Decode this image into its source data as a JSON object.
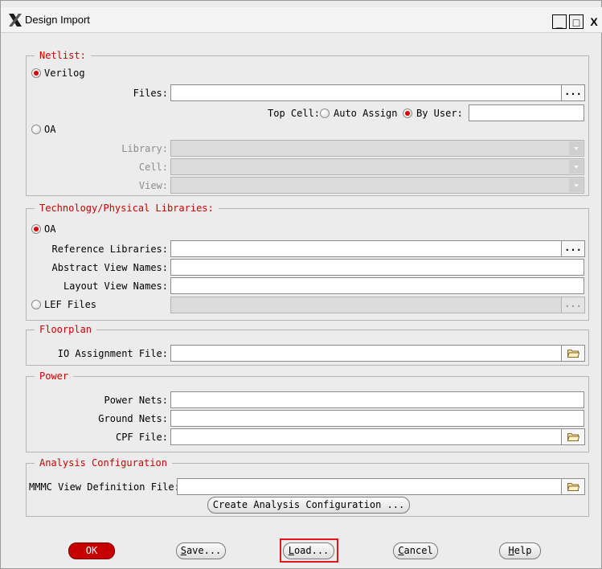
{
  "window": {
    "title": "Design Import",
    "min_label": "_",
    "max_label": "□",
    "close_label": "X"
  },
  "netlist": {
    "legend": "Netlist:",
    "verilog_label": "Verilog",
    "verilog_selected": true,
    "files_label": "Files:",
    "files_value": "",
    "browse_label": "...",
    "top_cell_label": "Top Cell:",
    "auto_assign_label": "Auto Assign",
    "by_user_label": "By User:",
    "by_user_selected": true,
    "top_cell_value": "",
    "oa_label": "OA",
    "oa_selected": false,
    "library_label": "Library:",
    "cell_label": "Cell:",
    "view_label": "View:"
  },
  "tech": {
    "legend": "Technology/Physical Libraries:",
    "oa_label": "OA",
    "oa_selected": true,
    "ref_libs_label": "Reference Libraries:",
    "browse_label": "...",
    "abstract_label": "Abstract View Names:",
    "layout_label": "Layout View Names:",
    "lef_label": "LEF Files",
    "lef_selected": false,
    "lef_browse_label": "..."
  },
  "floorplan": {
    "legend": "Floorplan",
    "io_label": "IO Assignment File:",
    "io_value": ""
  },
  "power": {
    "legend": "Power",
    "power_nets_label": "Power Nets:",
    "ground_nets_label": "Ground Nets:",
    "cpf_label": "CPF File:"
  },
  "analysis": {
    "legend": "Analysis Configuration",
    "mmmc_label": "MMMC View Definition File:",
    "create_button": "Create Analysis Configuration ..."
  },
  "buttons": {
    "ok": "OK",
    "save_u": "S",
    "save_rest": "ave...",
    "load_u": "L",
    "load_rest": "oad...",
    "cancel_u": "C",
    "cancel_rest": "ancel",
    "help_u": "H",
    "help_rest": "elp"
  },
  "icons": {
    "app_logo": "x-logo-icon",
    "folder": "folder-open-icon",
    "dropdown": "chevron-down-icon"
  },
  "colors": {
    "accent_red": "#cc0000",
    "ok_button": "#c60000",
    "highlight": "#e8141b"
  }
}
